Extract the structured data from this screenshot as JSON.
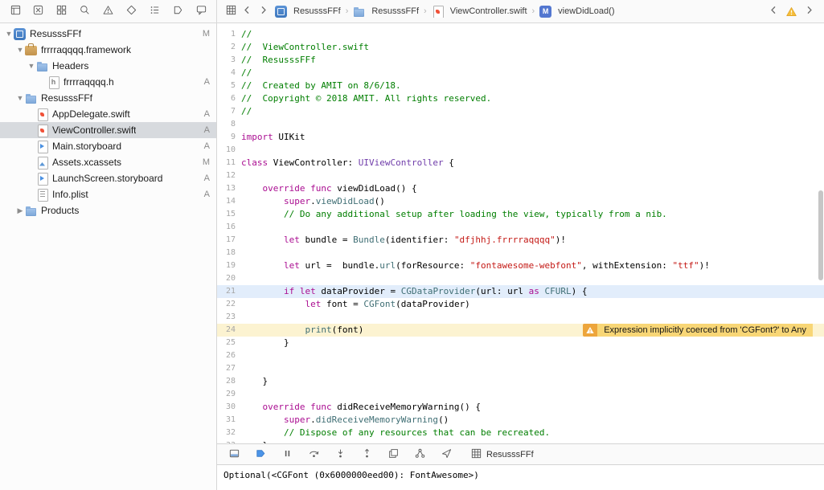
{
  "toolbar": {
    "navigator_tabs": [
      "project-navigator",
      "source-control-navigator",
      "symbol-navigator",
      "find-navigator",
      "issue-navigator",
      "test-navigator",
      "debug-navigator",
      "breakpoint-navigator",
      "report-navigator"
    ],
    "jump_bar": {
      "related_items_icon": "related-items-grid",
      "back_icon": "chevron-left",
      "forward_icon": "chevron-right",
      "breadcrumb": [
        {
          "type": "project",
          "label": "ResusssFFf"
        },
        {
          "type": "folder",
          "label": "ResusssFFf"
        },
        {
          "type": "swift",
          "label": "ViewController.swift"
        },
        {
          "type": "method",
          "label": "viewDidLoad()"
        }
      ]
    },
    "issue_stepper": {
      "prev_icon": "chevron-left",
      "warning_icon": "warning-triangle",
      "next_icon": "chevron-right"
    }
  },
  "sidebar": {
    "items": [
      {
        "label": "ResusssFFf",
        "icon": "project",
        "level": 0,
        "disclosure": "open",
        "badge": "M",
        "selected": false
      },
      {
        "label": "frrrraqqqq.framework",
        "icon": "framework",
        "level": 1,
        "disclosure": "open",
        "badge": "",
        "selected": false
      },
      {
        "label": "Headers",
        "icon": "folder",
        "level": 2,
        "disclosure": "open",
        "badge": "",
        "selected": false
      },
      {
        "label": "frrrraqqqq.h",
        "icon": "hfile",
        "level": 3,
        "disclosure": "",
        "badge": "A",
        "selected": false
      },
      {
        "label": "ResusssFFf",
        "icon": "folder",
        "level": 1,
        "disclosure": "open",
        "badge": "",
        "selected": false
      },
      {
        "label": "AppDelegate.swift",
        "icon": "swift",
        "level": 2,
        "disclosure": "",
        "badge": "A",
        "selected": false
      },
      {
        "label": "ViewController.swift",
        "icon": "swift",
        "level": 2,
        "disclosure": "",
        "badge": "A",
        "selected": true
      },
      {
        "label": "Main.storyboard",
        "icon": "storyboard",
        "level": 2,
        "disclosure": "",
        "badge": "A",
        "selected": false
      },
      {
        "label": "Assets.xcassets",
        "icon": "assets",
        "level": 2,
        "disclosure": "",
        "badge": "M",
        "selected": false
      },
      {
        "label": "LaunchScreen.storyboard",
        "icon": "storyboard",
        "level": 2,
        "disclosure": "",
        "badge": "A",
        "selected": false
      },
      {
        "label": "Info.plist",
        "icon": "plist",
        "level": 2,
        "disclosure": "",
        "badge": "A",
        "selected": false
      },
      {
        "label": "Products",
        "icon": "folder",
        "level": 1,
        "disclosure": "closed",
        "badge": "",
        "selected": false
      }
    ]
  },
  "editor": {
    "selected_line": 21,
    "issue": {
      "line": 24,
      "message": "Expression implicitly coerced from 'CGFont?' to Any"
    },
    "lines": [
      [
        [
          "c",
          "//"
        ]
      ],
      [
        [
          "c",
          "//  ViewController.swift"
        ]
      ],
      [
        [
          "c",
          "//  ResusssFFf"
        ]
      ],
      [
        [
          "c",
          "//"
        ]
      ],
      [
        [
          "c",
          "//  Created by AMIT on 8/6/18."
        ]
      ],
      [
        [
          "c",
          "//  Copyright © 2018 AMIT. All rights reserved."
        ]
      ],
      [
        [
          "c",
          "//"
        ]
      ],
      [],
      [
        [
          "k",
          "import"
        ],
        [
          "p",
          " UIKit"
        ]
      ],
      [],
      [
        [
          "k",
          "class"
        ],
        [
          "p",
          " ViewController: "
        ],
        [
          "pt",
          "UIViewController"
        ],
        [
          "p",
          " {"
        ]
      ],
      [],
      [
        [
          "p",
          "    "
        ],
        [
          "k",
          "override"
        ],
        [
          "p",
          " "
        ],
        [
          "k",
          "func"
        ],
        [
          "p",
          " viewDidLoad() {"
        ]
      ],
      [
        [
          "p",
          "        "
        ],
        [
          "k",
          "super"
        ],
        [
          "p",
          "."
        ],
        [
          "f",
          "viewDidLoad"
        ],
        [
          "p",
          "()"
        ]
      ],
      [
        [
          "p",
          "        "
        ],
        [
          "c",
          "// Do any additional setup after loading the view, typically from a nib."
        ]
      ],
      [],
      [
        [
          "p",
          "        "
        ],
        [
          "k",
          "let"
        ],
        [
          "p",
          " bundle = "
        ],
        [
          "t",
          "Bundle"
        ],
        [
          "p",
          "(identifier: "
        ],
        [
          "s",
          "\"dfjhhj.frrrraqqqq\""
        ],
        [
          "p",
          ")!"
        ]
      ],
      [],
      [
        [
          "p",
          "        "
        ],
        [
          "k",
          "let"
        ],
        [
          "p",
          " url =  bundle."
        ],
        [
          "f",
          "url"
        ],
        [
          "p",
          "(forResource: "
        ],
        [
          "s",
          "\"fontawesome-webfont\""
        ],
        [
          "p",
          ", withExtension: "
        ],
        [
          "s",
          "\"ttf\""
        ],
        [
          "p",
          ")!"
        ]
      ],
      [],
      [
        [
          "p",
          "        "
        ],
        [
          "k",
          "if"
        ],
        [
          "p",
          " "
        ],
        [
          "k",
          "let"
        ],
        [
          "p",
          " dataProvider = "
        ],
        [
          "t",
          "CGDataProvider"
        ],
        [
          "p",
          "(url: url "
        ],
        [
          "k",
          "as"
        ],
        [
          "p",
          " "
        ],
        [
          "t",
          "CFURL"
        ],
        [
          "p",
          ") {"
        ]
      ],
      [
        [
          "p",
          "            "
        ],
        [
          "k",
          "let"
        ],
        [
          "p",
          " font = "
        ],
        [
          "t",
          "CGFont"
        ],
        [
          "p",
          "(dataProvider)"
        ]
      ],
      [],
      [
        [
          "p",
          "            "
        ],
        [
          "f",
          "print"
        ],
        [
          "p",
          "(font)"
        ]
      ],
      [
        [
          "p",
          "        }"
        ]
      ],
      [],
      [],
      [
        [
          "p",
          "    }"
        ]
      ],
      [],
      [
        [
          "p",
          "    "
        ],
        [
          "k",
          "override"
        ],
        [
          "p",
          " "
        ],
        [
          "k",
          "func"
        ],
        [
          "p",
          " didReceiveMemoryWarning() {"
        ]
      ],
      [
        [
          "p",
          "        "
        ],
        [
          "k",
          "super"
        ],
        [
          "p",
          "."
        ],
        [
          "f",
          "didReceiveMemoryWarning"
        ],
        [
          "p",
          "()"
        ]
      ],
      [
        [
          "p",
          "        "
        ],
        [
          "c",
          "// Dispose of any resources that can be recreated."
        ]
      ],
      [
        [
          "p",
          "    }"
        ]
      ]
    ]
  },
  "debug_bar": {
    "buttons": [
      "toggle-debug-area",
      "breakpoints",
      "pause",
      "step-over",
      "step-into",
      "step-out",
      "view-debugger",
      "memory-graph",
      "simulate-location"
    ],
    "jump_icon": "stack-grid",
    "jump_label": "ResusssFFf"
  },
  "console": {
    "text": "Optional(<CGFont (0x6000000eed00): FontAwesome>)"
  },
  "colors": {
    "warning_accent": "#eda53b",
    "selected_line_bg": "#e2edfb",
    "warning_line_bg": "#fcf3d1"
  }
}
